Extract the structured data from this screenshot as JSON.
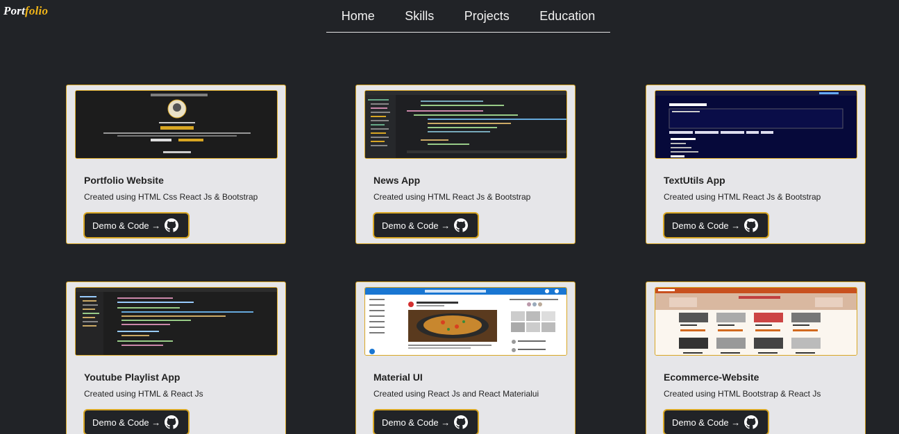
{
  "logo": {
    "part1": "Port",
    "part2": "folio"
  },
  "nav": [
    "Home",
    "Skills",
    "Projects",
    "Education"
  ],
  "button_label": "Demo & Code →",
  "projects": [
    {
      "title": "Portfolio Website",
      "desc": "Created using HTML Css React Js & Bootstrap"
    },
    {
      "title": "News App",
      "desc": "Created using HTML React Js & Bootstrap"
    },
    {
      "title": "TextUtils App",
      "desc": "Created using HTML React Js & Bootstrap"
    },
    {
      "title": "Youtube Playlist App",
      "desc": "Created using HTML & React Js"
    },
    {
      "title": "Material UI",
      "desc": "Created using React Js and React Materialui"
    },
    {
      "title": "Ecommerce-Website",
      "desc": "Created using HTML Bootstrap & React Js"
    }
  ],
  "colors": {
    "background": "#212327",
    "accent": "#d8a623",
    "card": "#e6e6e9"
  },
  "icons": {
    "button_icon": "github-icon"
  }
}
